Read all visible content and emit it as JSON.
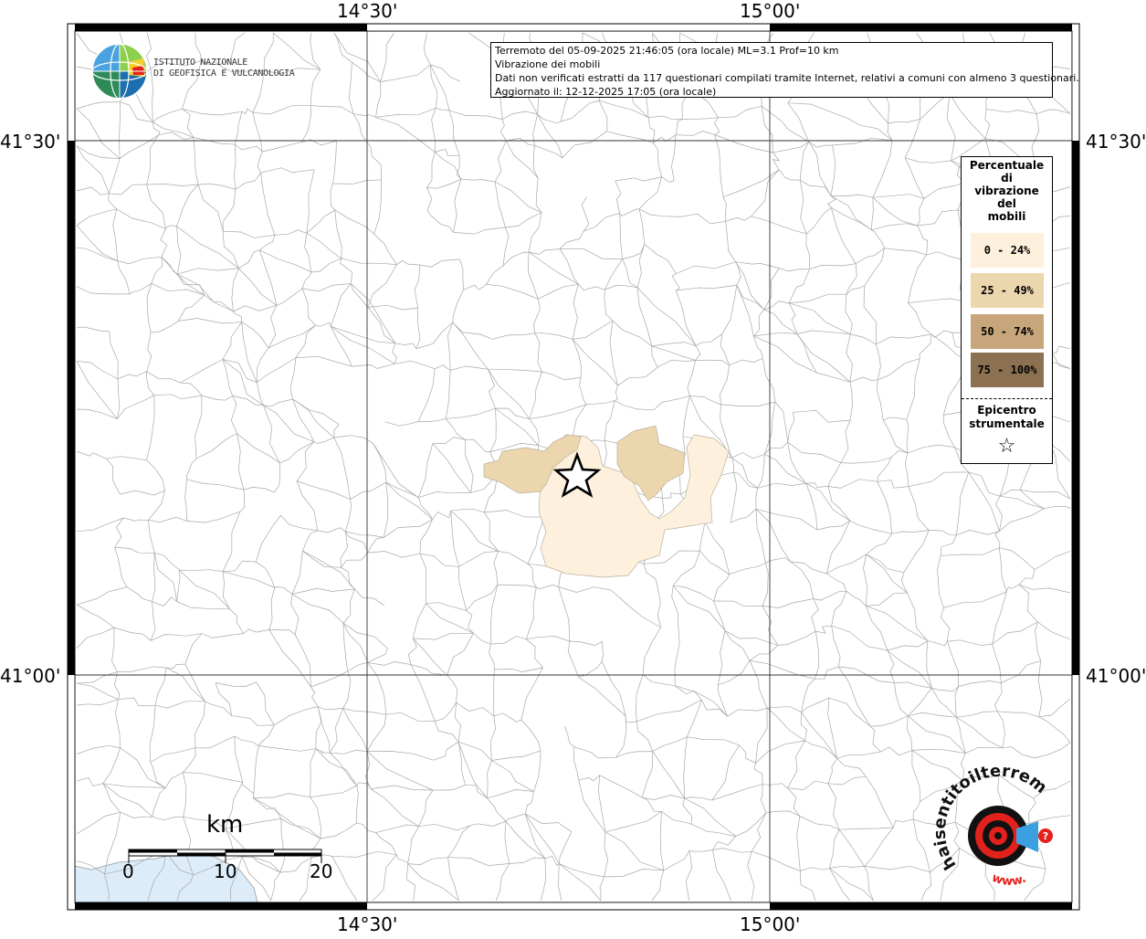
{
  "map": {
    "lon_labels": [
      "14°30'",
      "15°00'"
    ],
    "lat_labels": [
      "41°30'",
      "41°00'"
    ]
  },
  "info": {
    "line1": "Terremoto del 05-09-2025 21:46:05 (ora locale) ML=3.1 Prof=10 km",
    "line2": "Vibrazione dei mobili",
    "line3": "Dati non verificati estratti da 117 questionari compilati tramite Internet, relativi a comuni con almeno 3 questionari.",
    "line4": "Aggiornato il: 12-12-2025 17:05 (ora locale)"
  },
  "ingv_logo": {
    "line1": "ISTITUTO NAZIONALE",
    "line2": "DI GEOFISICA E VULCANOLOGIA"
  },
  "legend": {
    "title_lines": [
      "Percentuale",
      "di",
      "vibrazione",
      "del",
      "mobili"
    ],
    "classes": [
      {
        "label": "0 - 24%",
        "color": "#fdf0dc"
      },
      {
        "label": "25 - 49%",
        "color": "#ecd6ad"
      },
      {
        "label": "50 - 74%",
        "color": "#c8a67c"
      },
      {
        "label": "75 - 100%",
        "color": "#8b7152"
      }
    ],
    "epicenter_lines": [
      "Epicentro",
      "strumentale"
    ],
    "epicenter_symbol": "☆"
  },
  "scale_bar": {
    "unit": "km",
    "ticks": [
      "0",
      "10",
      "20"
    ]
  },
  "watermark": {
    "text": "haisentitoilterremoto.it",
    "prefix": "www."
  },
  "colors": {
    "border": "#000000",
    "boundary": "#9a9a9a",
    "sea": "#dcecf8",
    "accent_red": "#e3211c"
  }
}
